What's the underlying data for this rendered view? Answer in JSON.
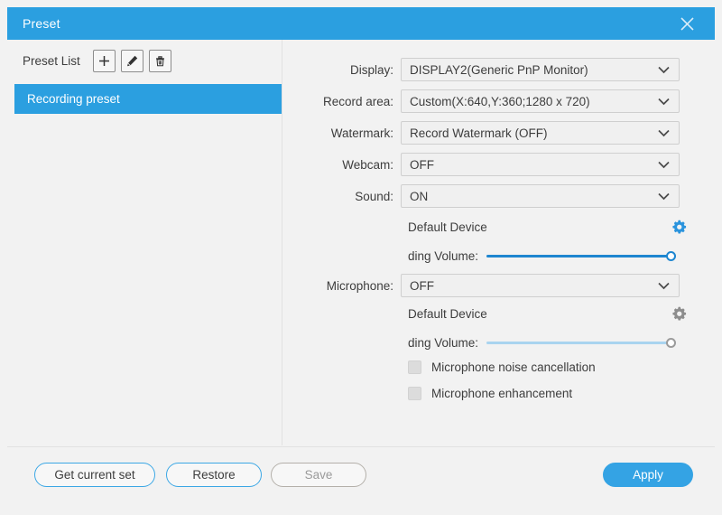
{
  "window": {
    "title": "Preset",
    "close_icon": "close-icon"
  },
  "sidebar": {
    "list_label": "Preset List",
    "actions": [
      {
        "name": "add-preset-button",
        "icon": "plus-icon"
      },
      {
        "name": "edit-preset-button",
        "icon": "pencil-icon"
      },
      {
        "name": "delete-preset-button",
        "icon": "trash-icon"
      }
    ],
    "items": [
      {
        "label": "Recording preset",
        "selected": true
      }
    ]
  },
  "form": {
    "display": {
      "label": "Display:",
      "value": "DISPLAY2(Generic PnP Monitor)"
    },
    "record_area": {
      "label": "Record area:",
      "value": "Custom(X:640,Y:360;1280 x 720)"
    },
    "watermark": {
      "label": "Watermark:",
      "value": "Record Watermark (OFF)"
    },
    "webcam": {
      "label": "Webcam:",
      "value": "OFF"
    },
    "sound": {
      "label": "Sound:",
      "value": "ON",
      "device": "Default Device",
      "device_settings_icon": "gear-icon",
      "volume_label": "ding Volume:",
      "volume_percent": 100
    },
    "microphone": {
      "label": "Microphone:",
      "value": "OFF",
      "device": "Default Device",
      "device_settings_icon": "gear-icon",
      "volume_label": "ding Volume:",
      "volume_percent": 100
    },
    "checkboxes": [
      {
        "label": "Microphone noise cancellation",
        "checked": false
      },
      {
        "label": "Microphone enhancement",
        "checked": false
      }
    ]
  },
  "footer": {
    "get_current_set": "Get current set",
    "restore": "Restore",
    "save": "Save",
    "apply": "Apply"
  },
  "colors": {
    "accent": "#2b9fe0",
    "primary_button": "#34a3e4",
    "slider_active": "#1e86d0",
    "slider_disabled": "#a9d4ef",
    "panel_bg": "#f2f2f2"
  }
}
